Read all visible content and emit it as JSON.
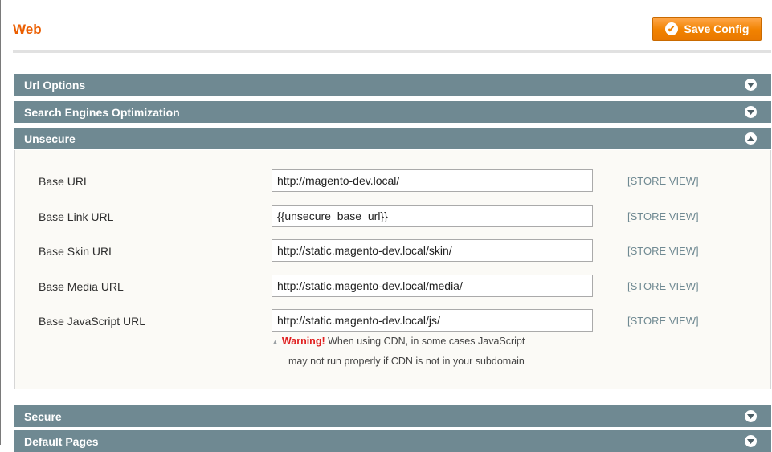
{
  "page": {
    "title": "Web",
    "save_label": "Save Config",
    "save_icon": "check-icon"
  },
  "sections": {
    "url_options": {
      "label": "Url Options",
      "state": "collapsed"
    },
    "seo": {
      "label": "Search Engines Optimization",
      "state": "collapsed"
    },
    "unsecure": {
      "label": "Unsecure",
      "state": "expanded"
    },
    "secure": {
      "label": "Secure",
      "state": "collapsed"
    },
    "default_pages": {
      "label": "Default Pages",
      "state": "collapsed"
    }
  },
  "fields": {
    "base_url": {
      "label": "Base URL",
      "value": "http://magento-dev.local/",
      "scope": "[STORE VIEW]"
    },
    "base_link_url": {
      "label": "Base Link URL",
      "value": "{{unsecure_base_url}}",
      "scope": "[STORE VIEW]"
    },
    "base_skin_url": {
      "label": "Base Skin URL",
      "value": "http://static.magento-dev.local/skin/",
      "scope": "[STORE VIEW]"
    },
    "base_media_url": {
      "label": "Base Media URL",
      "value": "http://static.magento-dev.local/media/",
      "scope": "[STORE VIEW]"
    },
    "base_js_url": {
      "label": "Base JavaScript URL",
      "value": "http://static.magento-dev.local/js/",
      "scope": "[STORE VIEW]"
    }
  },
  "warning": {
    "label": "Warning!",
    "line1": "When using CDN, in some cases JavaScript",
    "line2": "may not run properly if CDN is not in your subdomain"
  },
  "colors": {
    "accent": "#eb5e00",
    "section_header": "#6f8992",
    "button": "#f18200",
    "warning": "#e02020"
  }
}
